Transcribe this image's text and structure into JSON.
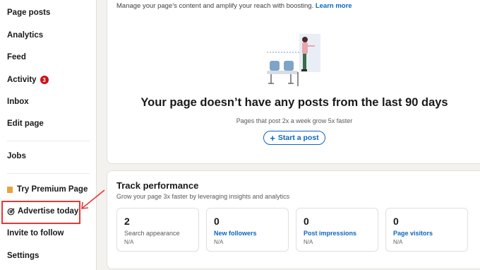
{
  "sidebar": {
    "items": [
      {
        "label": "Page posts"
      },
      {
        "label": "Analytics"
      },
      {
        "label": "Feed"
      },
      {
        "label": "Activity",
        "badge": "3"
      },
      {
        "label": "Inbox"
      },
      {
        "label": "Edit page"
      },
      {
        "label": "Jobs"
      },
      {
        "label": "Try Premium Page",
        "icon": "premium-icon"
      },
      {
        "label": "Advertise today",
        "icon": "target-icon"
      },
      {
        "label": "Invite to follow"
      },
      {
        "label": "Settings"
      }
    ]
  },
  "top_card": {
    "intro": "Manage your page’s content and amplify your reach with boosting.",
    "learn_more": "Learn more",
    "empty_title": "Your page doesn’t have any posts from the last 90 days",
    "empty_subtitle": "Pages that post 2x a week grow 5x faster",
    "start_post_button": "Start a post",
    "start_post_icon": "+"
  },
  "performance": {
    "title": "Track performance",
    "subtitle": "Grow your page 3x faster by leveraging insights and analytics",
    "metrics": [
      {
        "value": "2",
        "label": "Search appearance",
        "change": "N/A"
      },
      {
        "value": "0",
        "label": "New followers",
        "change": "N/A"
      },
      {
        "value": "0",
        "label": "Post impressions",
        "change": "N/A"
      },
      {
        "value": "0",
        "label": "Page visitors",
        "change": "N/A"
      }
    ]
  },
  "colors": {
    "accent_blue": "#0a66c2",
    "badge_red": "#cc1016",
    "highlight_red": "#e53935",
    "premium_gold": "#e7a33e"
  }
}
